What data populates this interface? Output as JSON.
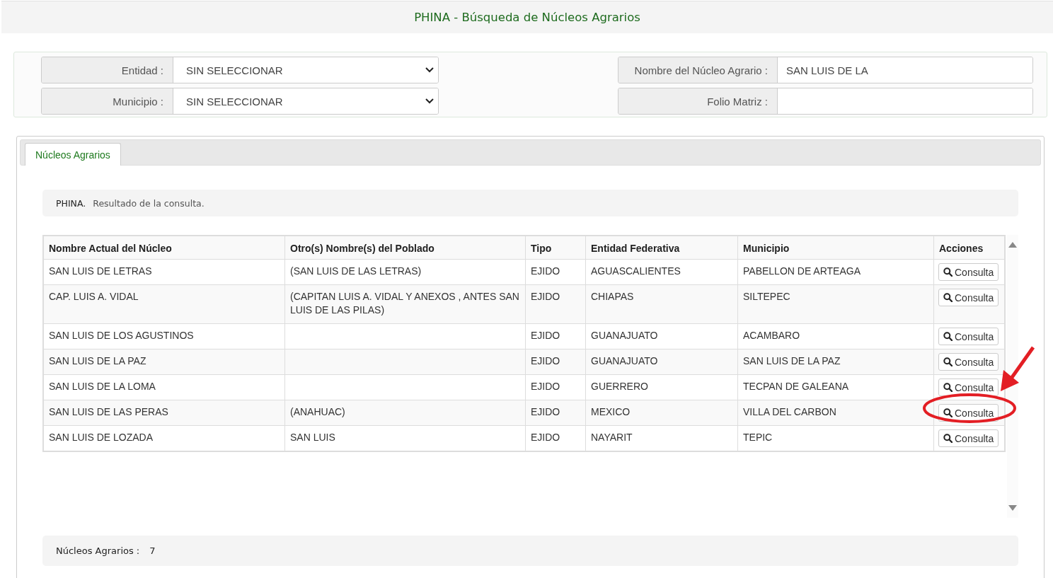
{
  "header": {
    "title": "PHINA - Búsqueda de Núcleos Agrarios"
  },
  "filters": {
    "left": [
      {
        "label": "Entidad :",
        "kind": "select",
        "value": "SIN SELECCIONAR"
      },
      {
        "label": "Municipio :",
        "kind": "select",
        "value": "SIN SELECCIONAR"
      }
    ],
    "right": [
      {
        "label": "Nombre del Núcleo Agrario :",
        "kind": "text",
        "value": "SAN LUIS DE LA"
      },
      {
        "label": "Folio Matriz :",
        "kind": "text"
      }
    ]
  },
  "tabs": [
    {
      "label": "Núcleos Agrarios",
      "selected": true
    }
  ],
  "message": {
    "title": "PHINA.",
    "text": "Resultado de la consulta."
  },
  "table": {
    "columns": [
      "Nombre Actual del Núcleo",
      "Otro(s) Nombre(s) del Poblado",
      "Tipo",
      "Entidad Federativa",
      "Municipio",
      "Acciones"
    ],
    "rows": [
      {
        "cells": [
          "SAN LUIS DE LETRAS",
          "(SAN LUIS DE LAS LETRAS)",
          "EJIDO",
          "AGUASCALIENTES",
          "PABELLON DE ARTEAGA"
        ],
        "action": "Consulta",
        "highlighted": false
      },
      {
        "cells": [
          "CAP. LUIS A. VIDAL",
          "(CAPITAN LUIS A. VIDAL Y ANEXOS , ANTES SAN LUIS DE LAS PILAS)",
          "EJIDO",
          "CHIAPAS",
          "SILTEPEC"
        ],
        "action": "Consulta",
        "highlighted": false
      },
      {
        "cells": [
          "SAN LUIS DE LOS AGUSTINOS",
          "",
          "EJIDO",
          "GUANAJUATO",
          "ACAMBARO"
        ],
        "action": "Consulta",
        "highlighted": false
      },
      {
        "cells": [
          "SAN LUIS DE LA PAZ",
          "",
          "EJIDO",
          "GUANAJUATO",
          "SAN LUIS DE LA PAZ"
        ],
        "action": "Consulta",
        "highlighted": false
      },
      {
        "cells": [
          "SAN LUIS DE LA LOMA",
          "",
          "EJIDO",
          "GUERRERO",
          "TECPAN DE GALEANA"
        ],
        "action": "Consulta",
        "highlighted": false
      },
      {
        "cells": [
          "SAN LUIS DE LAS PERAS",
          "(ANAHUAC)",
          "EJIDO",
          "MEXICO",
          "VILLA DEL CARBON"
        ],
        "action": "Consulta",
        "highlighted": true
      },
      {
        "cells": [
          "SAN LUIS DE LOZADA",
          "SAN LUIS",
          "EJIDO",
          "NAYARIT",
          "TEPIC"
        ],
        "action": "Consulta",
        "highlighted": false
      }
    ]
  },
  "footer": {
    "label": "Núcleos Agrarios :",
    "count": "7"
  }
}
